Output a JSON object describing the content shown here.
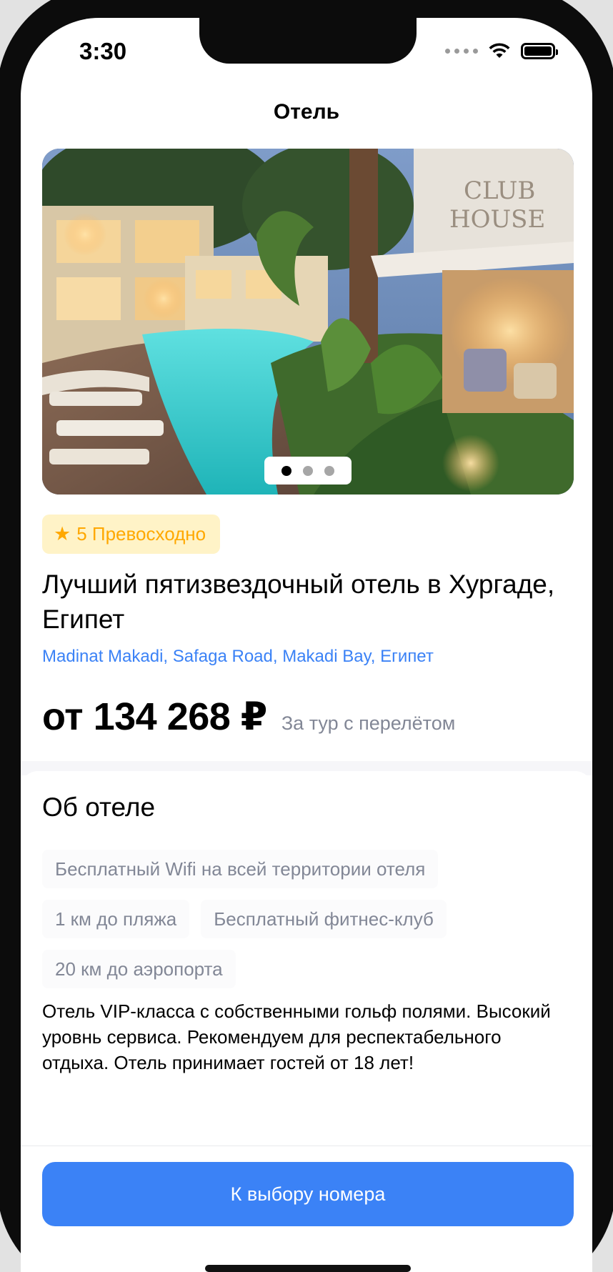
{
  "status_bar": {
    "time": "3:30"
  },
  "nav": {
    "title": "Отель"
  },
  "gallery": {
    "page_count": 3,
    "active_page": 1
  },
  "hotel": {
    "rating_value": "5",
    "rating_label": "5 Превосходно",
    "name": "Лучший пятизвездочный отель в Хургаде, Египет",
    "address": "Madinat Makadi, Safaga Road, Makadi Bay, Египет",
    "price": "от 134 268 ₽",
    "price_note": "За тур с перелётом"
  },
  "about": {
    "title": "Об отеле",
    "tags": [
      "Бесплатный Wifi на всей территории отеля",
      "1 км до пляжа",
      "Бесплатный фитнес-клуб",
      "20 км до аэропорта"
    ],
    "description": "Отель VIP-класса с собственными гольф полями. Высокий уровнь сервиса. Рекомендуем для респектабельного отдыха. Отель принимает гостей от 18 лет!"
  },
  "footer": {
    "cta_label": "К выбору номера"
  },
  "colors": {
    "accent": "#3b82f6",
    "rating_bg": "#fff3c7",
    "rating_fg": "#ffa800",
    "muted_text": "#828796",
    "tag_bg": "#fbfbfc"
  },
  "icons": [
    "wifi-icon",
    "battery-icon",
    "signal-dots-icon",
    "star-icon"
  ]
}
